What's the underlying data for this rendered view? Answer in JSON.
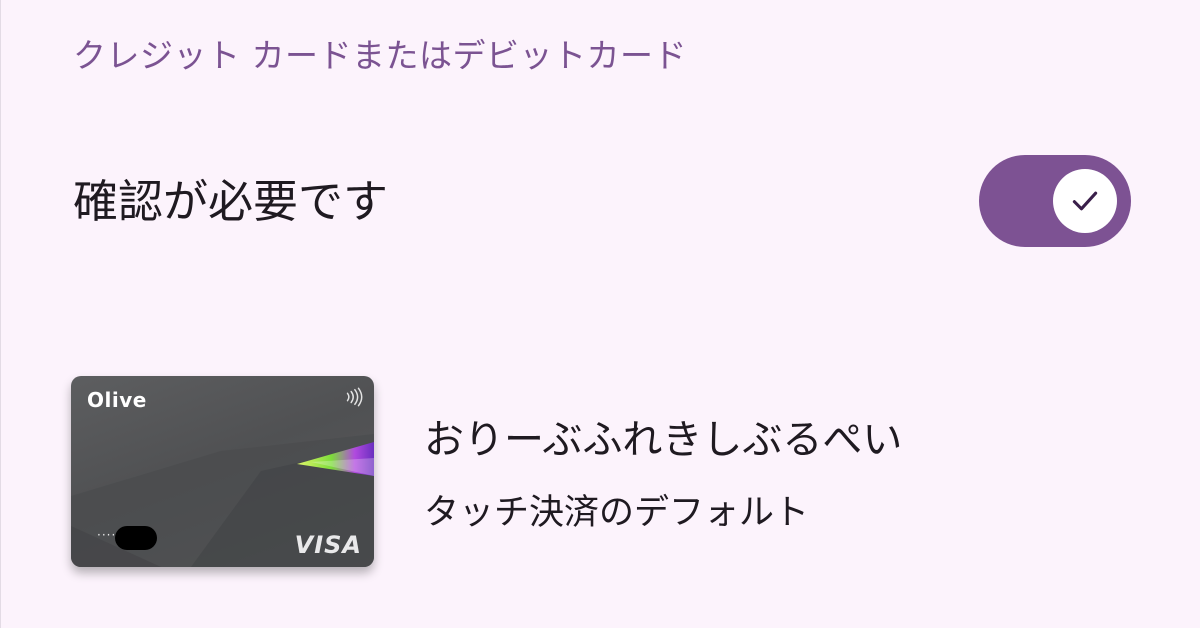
{
  "section": {
    "title": "クレジット カードまたはデビットカード"
  },
  "verification": {
    "label": "確認が必要です",
    "enabled": true,
    "toggle_icon": "check-icon"
  },
  "payment_card": {
    "brand": "Olive",
    "number_masked": "····",
    "network": "VISA",
    "name": "おりーぶふれきしぶるぺい",
    "subtitle": "タッチ決済のデフォルト",
    "contactless_icon": "contactless-icon"
  },
  "colors": {
    "background": "#fcf3fc",
    "accent": "#7d5293",
    "header_text": "#7b5392",
    "primary_text": "#1f1a21",
    "card_body": "#555658"
  }
}
